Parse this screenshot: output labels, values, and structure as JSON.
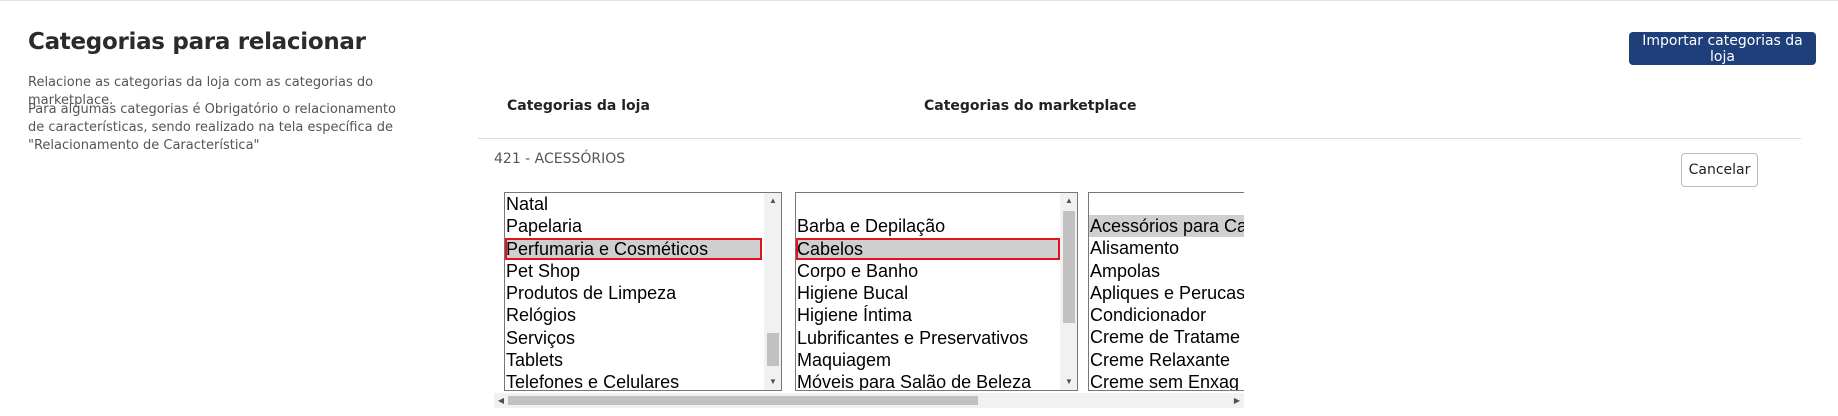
{
  "page": {
    "title": "Categorias para relacionar",
    "description_1": "Relacione as categorias da loja com as categorias do marketplace.",
    "description_2": "Para algumas categorias é Obrigatório o relacionamento de características, sendo realizado na tela específica de \"Relacionamento de Característica\""
  },
  "actions": {
    "import_label": "Importar categorias da loja",
    "cancel_label": "Cancelar"
  },
  "columns": {
    "store": "Categorias da loja",
    "marketplace": "Categorias do marketplace"
  },
  "current_category": "421 - ACESSÓRIOS",
  "store_categories": [
    "Natal",
    "Papelaria",
    "Perfumaria e Cosméticos",
    "Pet Shop",
    "Produtos de Limpeza",
    "Relógios",
    "Serviços",
    "Tablets",
    "Telefones e Celulares"
  ],
  "store_selected": "Perfumaria e Cosméticos",
  "marketplace_categories": [
    "",
    "Barba e Depilação",
    "Cabelos",
    "Corpo e Banho",
    "Higiene Bucal",
    "Higiene Íntima",
    "Lubrificantes e Preservativos",
    "Maquiagem",
    "Móveis para Salão de Beleza"
  ],
  "marketplace_selected": "Cabelos",
  "marketplace_subcategories": [
    "Acessórios para Ca",
    "Alisamento",
    "Ampolas",
    "Apliques e Perucas",
    "Condicionador",
    "Creme de Tratame",
    "Creme Relaxante",
    "Creme sem Enxag"
  ],
  "subcategory_selected": "Acessórios para Ca",
  "icons": {
    "scroll_up": "scroll-up-arrow",
    "scroll_down": "scroll-down-arrow",
    "scroll_left": "scroll-left-arrow",
    "scroll_right": "scroll-right-arrow"
  },
  "colors": {
    "primary_button": "#1e3f7a",
    "selection": "#cfcfcf",
    "highlight_outline": "#e0141e"
  }
}
